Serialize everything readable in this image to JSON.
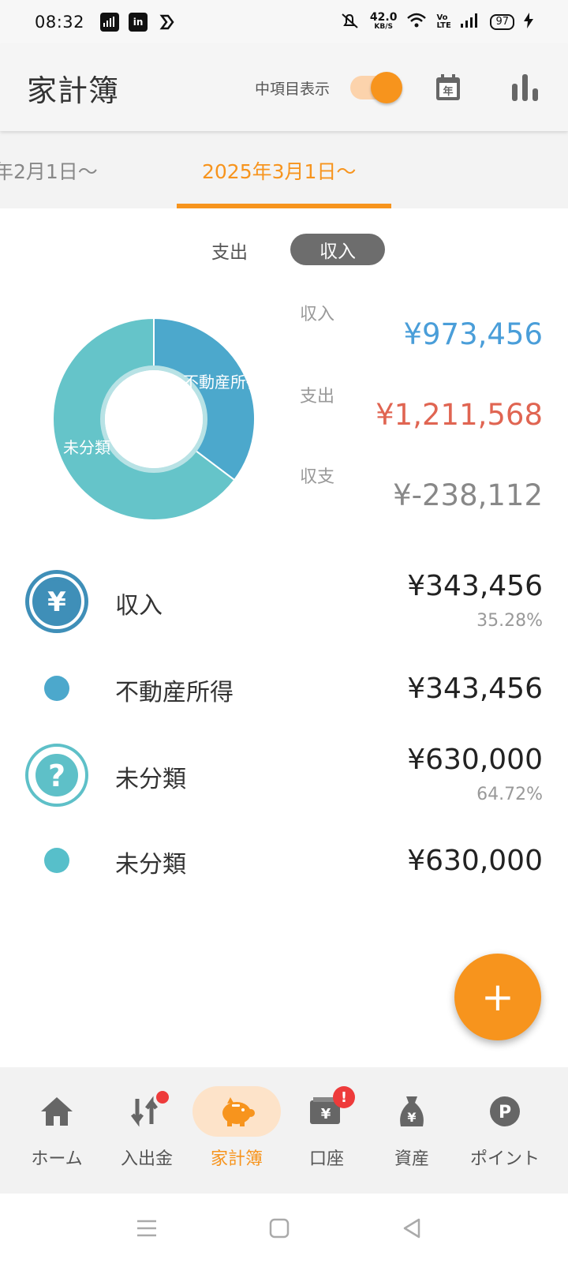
{
  "status_bar": {
    "time": "08:32",
    "net_speed_value": "42.0",
    "net_speed_unit": "KB/S",
    "volte": "Vo LTE",
    "battery": "97"
  },
  "header": {
    "title": "家計簿",
    "toggle_label": "中項目表示",
    "toggle_on": true,
    "calendar_icon_text": "年"
  },
  "period_tabs": {
    "previous": "年2月1日〜",
    "current": "2025年3月1日〜"
  },
  "type_switch": {
    "expense_label": "支出",
    "income_label": "収入",
    "selected": "収入"
  },
  "chart_data": {
    "type": "pie",
    "donut": true,
    "categories": [
      "不動産所得",
      "未分類"
    ],
    "values": [
      35.28,
      64.72
    ],
    "colors": [
      "#4ca8cc",
      "#65c4c9"
    ],
    "slice_labels": [
      "不動産所得",
      "未分類"
    ]
  },
  "summary": {
    "income_label": "収入",
    "income_value": "¥973,456",
    "expense_label": "支出",
    "expense_value": "¥1,211,568",
    "balance_label": "収支",
    "balance_value": "¥-238,112"
  },
  "breakdown": [
    {
      "label": "収入",
      "amount": "¥343,456",
      "percent": "35.28%",
      "icon": "yen-icon"
    },
    {
      "label": "不動産所得",
      "amount": "¥343,456",
      "dot_color": "#4ca8cc"
    },
    {
      "label": "未分類",
      "amount": "¥630,000",
      "percent": "64.72%",
      "icon": "question-icon"
    },
    {
      "label": "未分類",
      "amount": "¥630,000",
      "dot_color": "#57bfca"
    }
  ],
  "fab": {
    "symbol": "+"
  },
  "bottom_nav": [
    {
      "label": "ホーム",
      "icon": "home-icon"
    },
    {
      "label": "入出金",
      "icon": "transfer-icon"
    },
    {
      "label": "家計簿",
      "icon": "piggy-bank-icon",
      "active": true
    },
    {
      "label": "口座",
      "icon": "wallet-icon",
      "badge": "!"
    },
    {
      "label": "資産",
      "icon": "money-bag-icon"
    },
    {
      "label": "ポイント",
      "icon": "point-icon",
      "icon_text": "P"
    }
  ],
  "colors": {
    "accent": "#f7941d",
    "income": "#4a9ed9",
    "expense": "#e06552",
    "badge": "#ee3b3b"
  }
}
